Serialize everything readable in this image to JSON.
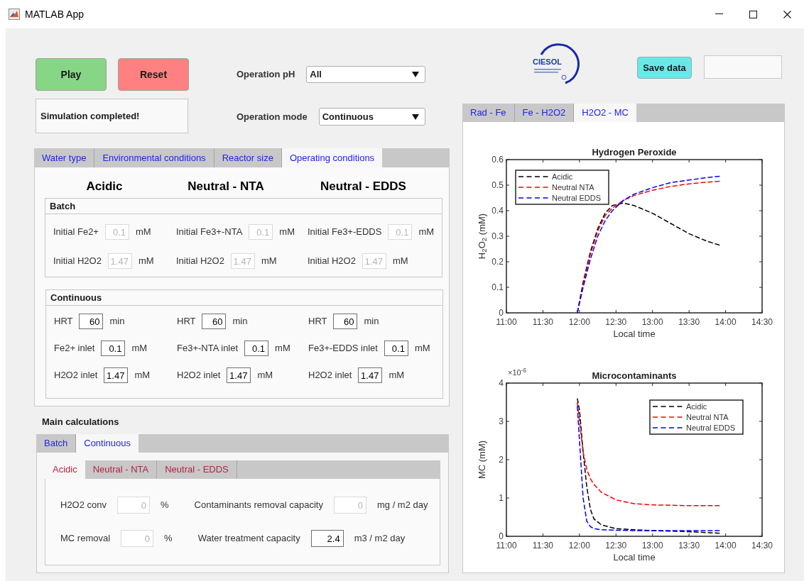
{
  "window": {
    "title": "MATLAB App"
  },
  "buttons": [
    {
      "label": "Play",
      "kind": "play"
    },
    {
      "label": "Reset",
      "kind": "reset"
    }
  ],
  "status": {
    "text": "Simulation completed!"
  },
  "selectors": [
    {
      "label": "Operation pH",
      "value": "All"
    },
    {
      "label": "Operation mode",
      "value": "Continuous"
    }
  ],
  "logo": {
    "text": "CIESOL"
  },
  "save_button": {
    "label": "Save data"
  },
  "settings_tabs": [
    {
      "label": "Water type",
      "selected": false
    },
    {
      "label": "Environmental conditions",
      "selected": false
    },
    {
      "label": "Reactor size",
      "selected": false
    },
    {
      "label": "Operating conditions",
      "selected": true
    }
  ],
  "regime_headings": [
    "Acidic",
    "Neutral - NTA",
    "Neutral - EDDS"
  ],
  "panels": [
    {
      "title": "Batch",
      "rows": [
        [
          {
            "label": "Initial Fe2+",
            "value": "0.1",
            "unit": "mM",
            "disabled": true
          },
          {
            "label": "Initial Fe3+-NTA",
            "value": "0.1",
            "unit": "mM",
            "disabled": true
          },
          {
            "label": "Initial Fe3+-EDDS",
            "value": "0.1",
            "unit": "mM",
            "disabled": true
          }
        ],
        [
          {
            "label": "Initial H2O2",
            "value": "1.47",
            "unit": "mM",
            "disabled": true
          },
          {
            "label": "Initial H2O2",
            "value": "1.47",
            "unit": "mM",
            "disabled": true
          },
          {
            "label": "Initial H2O2",
            "value": "1.47",
            "unit": "mM",
            "disabled": true
          }
        ]
      ]
    },
    {
      "title": "Continuous",
      "rows": [
        [
          {
            "label": "HRT",
            "value": "60",
            "unit": "min",
            "disabled": false
          },
          {
            "label": "HRT",
            "value": "60",
            "unit": "min",
            "disabled": false
          },
          {
            "label": "HRT",
            "value": "60",
            "unit": "min",
            "disabled": false
          }
        ],
        [
          {
            "label": "Fe2+ inlet",
            "value": "0.1",
            "unit": "mM",
            "disabled": false
          },
          {
            "label": "Fe3+-NTA inlet",
            "value": "0.1",
            "unit": "mM",
            "disabled": false
          },
          {
            "label": "Fe3+-EDDS inlet",
            "value": "0.1",
            "unit": "mM",
            "disabled": false
          }
        ],
        [
          {
            "label": "H2O2 inlet",
            "value": "1.47",
            "unit": "mM",
            "disabled": false
          },
          {
            "label": "H2O2 inlet",
            "value": "1.47",
            "unit": "mM",
            "disabled": false
          },
          {
            "label": "H2O2 inlet",
            "value": "1.47",
            "unit": "mM",
            "disabled": false
          }
        ]
      ]
    }
  ],
  "main_calculations": {
    "title": "Main calculations",
    "tabs": [
      {
        "label": "Batch",
        "selected": false
      },
      {
        "label": "Continuous",
        "selected": true
      }
    ],
    "regime_tabs": [
      {
        "label": "Acidic",
        "selected": true
      },
      {
        "label": "Neutral - NTA",
        "selected": false
      },
      {
        "label": "Neutral - EDDS",
        "selected": false
      }
    ],
    "rows": [
      [
        {
          "label": "H2O2 conv",
          "value": "0",
          "unit": "%",
          "disabled": true
        },
        {
          "label": "Contaminants removal capacity",
          "value": "0",
          "unit": "mg / m2 day",
          "disabled": true
        }
      ],
      [
        {
          "label": "MC removal",
          "value": "0",
          "unit": "%",
          "disabled": true
        },
        {
          "label": "Water treatment capacity",
          "value": "2.4",
          "unit": "m3 / m2 day",
          "disabled": false
        }
      ]
    ]
  },
  "plot_panel": {
    "tabs": [
      {
        "label": "Rad - Fe",
        "selected": false
      },
      {
        "label": "Fe - H2O2",
        "selected": false
      },
      {
        "label": "H2O2 - MC",
        "selected": true
      }
    ],
    "charts": [
      {
        "chart_data": {
          "type": "line",
          "legend": "upper left",
          "title": "Hydrogen Peroxide",
          "xlabel": "Local time",
          "ylabel": "H$_{2}$O$_{2}$ (mM)",
          "x": [
            11.97,
            12.05,
            12.15,
            12.25,
            12.35,
            12.45,
            12.6,
            12.75,
            13.0,
            13.25,
            13.5,
            13.75,
            13.92
          ],
          "series": [
            {
              "name": "Acidic",
              "color": "#000000",
              "line_style": "dashed",
              "values": [
                0,
                0.12,
                0.24,
                0.33,
                0.39,
                0.42,
                0.43,
                0.42,
                0.39,
                0.35,
                0.31,
                0.28,
                0.265
              ]
            },
            {
              "name": "Neutral NTA",
              "color": "#ff0000",
              "line_style": "dashed",
              "values": [
                0,
                0.11,
                0.23,
                0.32,
                0.38,
                0.41,
                0.44,
                0.46,
                0.48,
                0.495,
                0.505,
                0.512,
                0.515
              ]
            },
            {
              "name": "Neutral EDDS",
              "color": "#0000ff",
              "line_style": "dashed",
              "values": [
                0,
                0.1,
                0.21,
                0.3,
                0.36,
                0.4,
                0.44,
                0.465,
                0.49,
                0.51,
                0.52,
                0.53,
                0.535
              ]
            }
          ],
          "xlim": [
            11,
            14.5
          ],
          "ylim": [
            0,
            0.6
          ],
          "xticks": [
            {
              "value": 11,
              "label": "11:00"
            },
            {
              "value": 11.5,
              "label": "11:30"
            },
            {
              "value": 12,
              "label": "12:00"
            },
            {
              "value": 12.5,
              "label": "12:30"
            },
            {
              "value": 13,
              "label": "13:00"
            },
            {
              "value": 13.5,
              "label": "13:30"
            },
            {
              "value": 14,
              "label": "14:00"
            },
            {
              "value": 14.5,
              "label": "14:30"
            }
          ],
          "yticks": [
            {
              "value": 0,
              "label": "0"
            },
            {
              "value": 0.1,
              "label": "0.1"
            },
            {
              "value": 0.2,
              "label": "0.2"
            },
            {
              "value": 0.3,
              "label": "0.3"
            },
            {
              "value": 0.4,
              "label": "0.4"
            },
            {
              "value": 0.5,
              "label": "0.5"
            },
            {
              "value": 0.6,
              "label": "0.6"
            }
          ]
        }
      },
      {
        "chart_data": {
          "type": "line",
          "legend": "upper right",
          "title": "Microcontaminants",
          "xlabel": "Local time",
          "ylabel": "MC (mM)",
          "annotations": [
            "×10$^{-6}$"
          ],
          "x": [
            11.97,
            12.0,
            12.05,
            12.1,
            12.15,
            12.2,
            12.3,
            12.5,
            12.75,
            13.0,
            13.5,
            13.92
          ],
          "series": [
            {
              "name": "Acidic",
              "color": "#000000",
              "line_style": "dashed",
              "values": [
                3.6,
                3.3,
                2.2,
                1.3,
                0.7,
                0.45,
                0.3,
                0.2,
                0.17,
                0.15,
                0.12,
                0.08
              ]
            },
            {
              "name": "Neutral NTA",
              "color": "#ff0000",
              "line_style": "dashed",
              "values": [
                3.5,
                3.0,
                2.2,
                1.75,
                1.5,
                1.35,
                1.15,
                0.95,
                0.85,
                0.82,
                0.8,
                0.8
              ]
            },
            {
              "name": "Neutral EDDS",
              "color": "#0000ff",
              "line_style": "dashed",
              "values": [
                3.4,
                2.5,
                1.0,
                0.4,
                0.25,
                0.2,
                0.17,
                0.16,
                0.15,
                0.15,
                0.15,
                0.15
              ]
            }
          ],
          "xlim": [
            11,
            14.5
          ],
          "ylim": [
            0,
            4
          ],
          "xticks": [
            {
              "value": 11,
              "label": "11:00"
            },
            {
              "value": 11.5,
              "label": "11:30"
            },
            {
              "value": 12,
              "label": "12:00"
            },
            {
              "value": 12.5,
              "label": "12:30"
            },
            {
              "value": 13,
              "label": "13:00"
            },
            {
              "value": 13.5,
              "label": "13:30"
            },
            {
              "value": 14,
              "label": "14:00"
            },
            {
              "value": 14.5,
              "label": "14:30"
            }
          ],
          "yticks": [
            {
              "value": 0,
              "label": "0"
            },
            {
              "value": 1,
              "label": "1"
            },
            {
              "value": 2,
              "label": "2"
            },
            {
              "value": 3,
              "label": "3"
            },
            {
              "value": 4,
              "label": "4"
            }
          ]
        }
      }
    ]
  }
}
